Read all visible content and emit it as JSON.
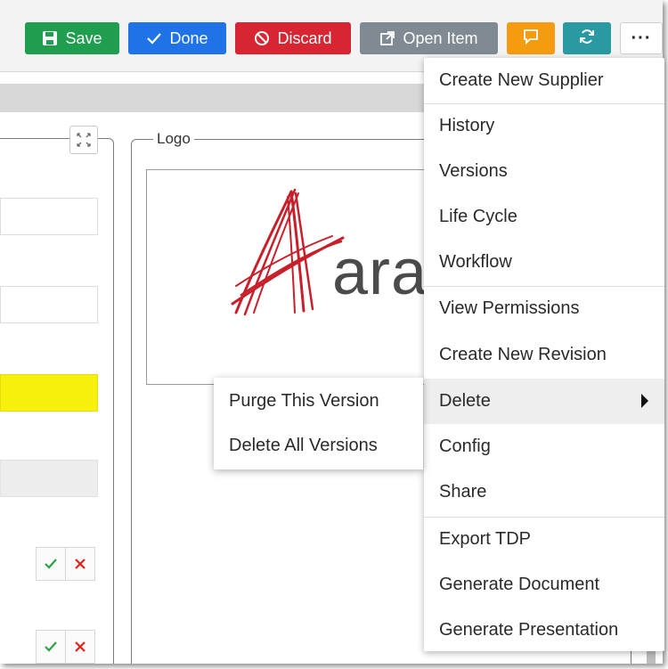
{
  "toolbar": {
    "save": "Save",
    "done": "Done",
    "discard": "Discard",
    "open_item": "Open Item",
    "more": "···"
  },
  "logo_section": {
    "legend": "Logo",
    "logo_text": "ara"
  },
  "menu": {
    "items": [
      "Create New Supplier",
      "History",
      "Versions",
      "Life Cycle",
      "Workflow",
      "View Permissions",
      "Create New Revision",
      "Delete",
      "Config",
      "Share",
      "Export TDP",
      "Generate Document",
      "Generate Presentation"
    ]
  },
  "submenu": {
    "items": [
      "Purge This Version",
      "Delete All Versions"
    ]
  },
  "icons": {
    "save": "save-icon",
    "done": "check-icon",
    "discard": "cancel-icon",
    "open": "external-link-icon",
    "comment": "comment-icon",
    "refresh": "refresh-icon",
    "submenu_arrow": "chevron-right-icon"
  },
  "colors": {
    "save": "#1e9e4e",
    "done": "#1f73e6",
    "discard": "#d72631",
    "open": "#7f8a93",
    "comment": "#f49b0f",
    "refresh": "#2a9aa2",
    "highlight_field": "#f6f00c",
    "logo_red": "#c8202a"
  }
}
